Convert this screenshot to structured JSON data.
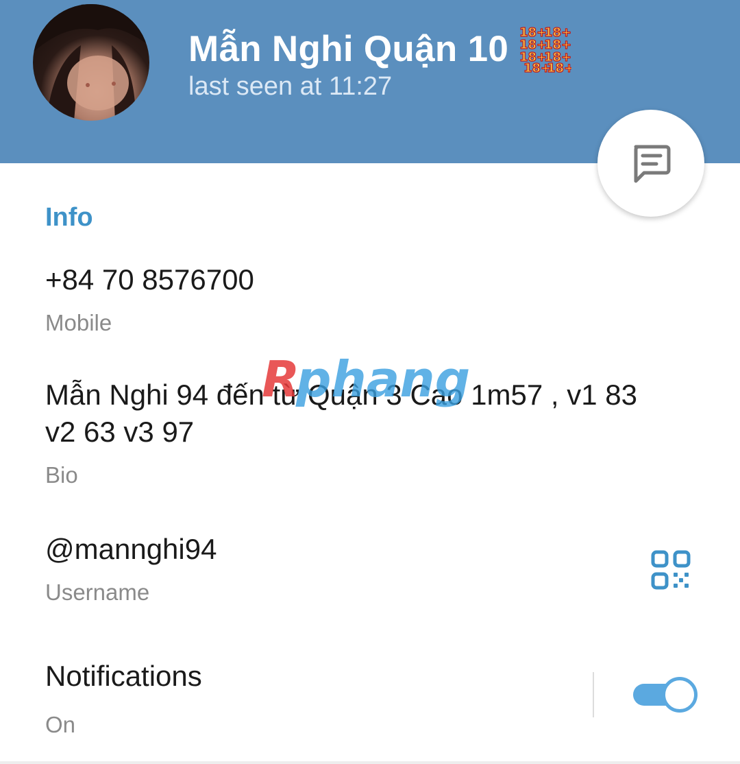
{
  "header": {
    "name": "Mẫn Nghi Quận 10",
    "status": "last seen at 11:27",
    "name_emoji": "18+",
    "bg_color": "#5b8fbe"
  },
  "fab": {
    "icon": "message-icon"
  },
  "info": {
    "section_title": "Info",
    "phone": {
      "value": "+84 70 8576700",
      "label": "Mobile"
    },
    "bio": {
      "line1": "Mẫn Nghi 94 đến từ Quận 3 Cao 1m57 , v1 83",
      "line2": "v2 63 v3 97",
      "label": "Bio"
    },
    "username": {
      "value": "@mannghi94",
      "label": "Username",
      "icon": "qr-code-icon"
    },
    "notifications": {
      "value": "Notifications",
      "label": "On",
      "enabled": true
    }
  },
  "watermark": {
    "text": "Rphang"
  },
  "colors": {
    "accent": "#3e92c8",
    "toggle": "#5ba9e0",
    "secondary_text": "#8a8a8a"
  }
}
